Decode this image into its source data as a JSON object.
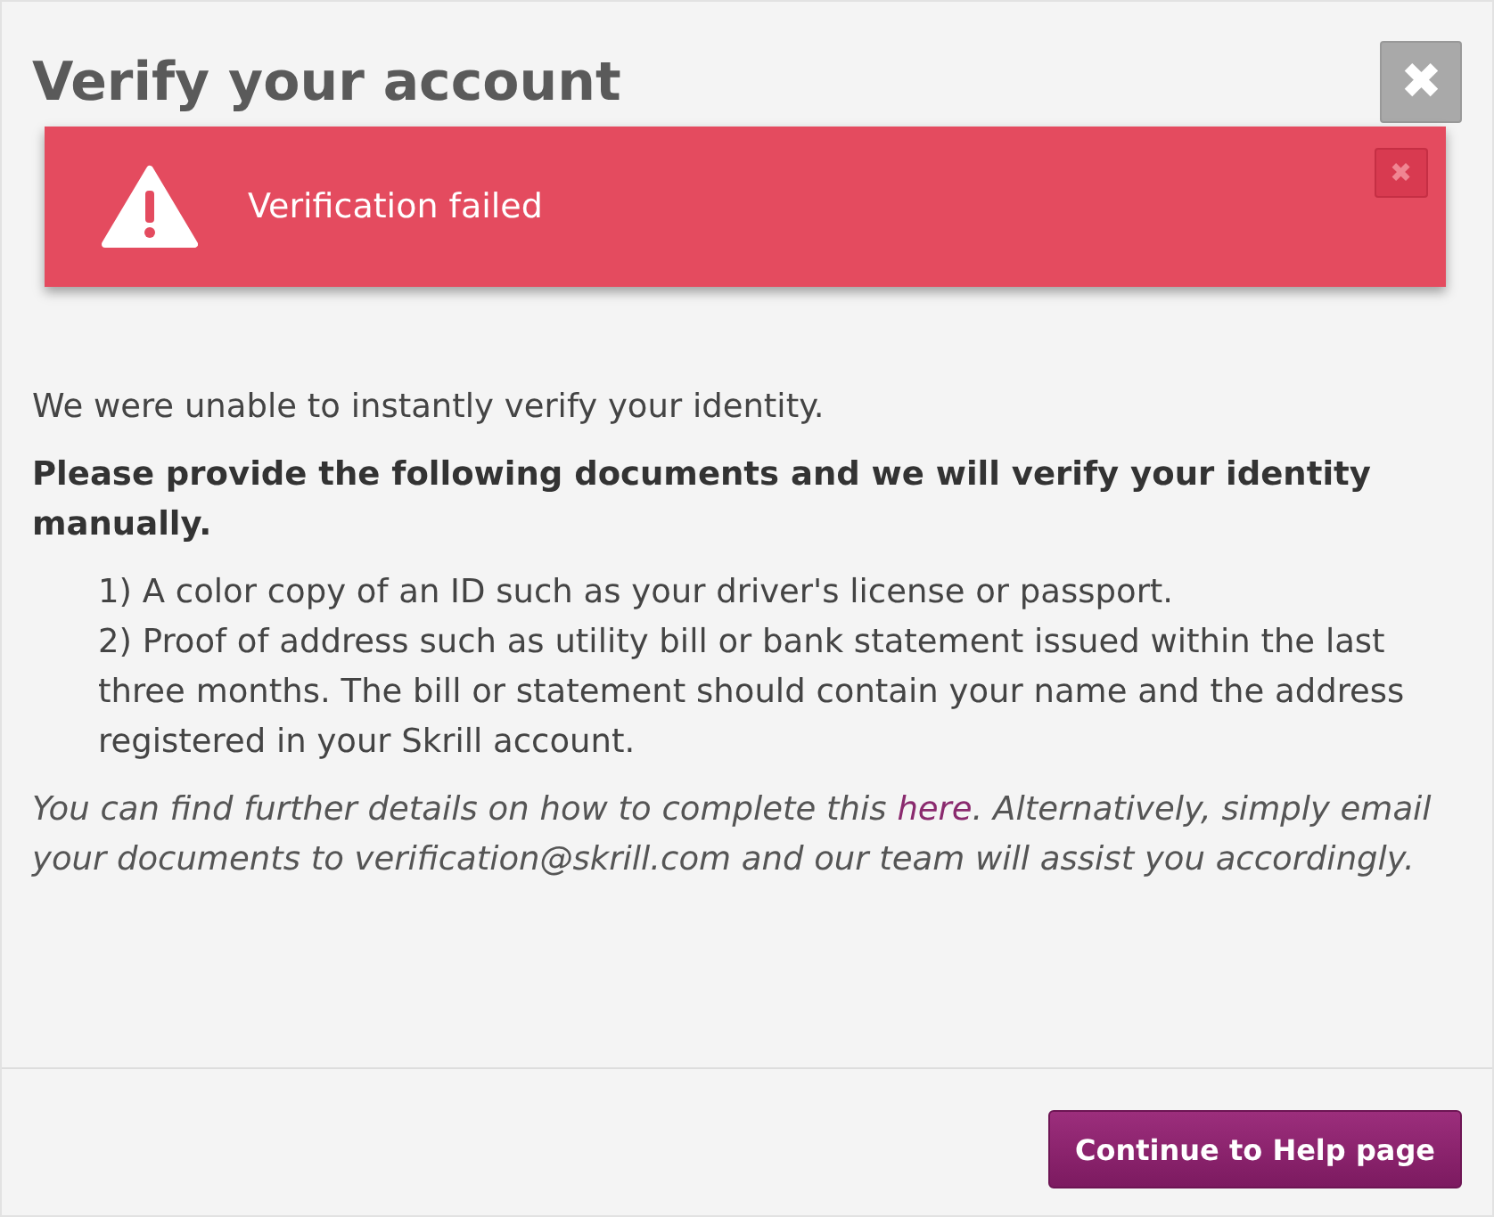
{
  "dialog": {
    "title": "Verify your account",
    "close_label": "✖"
  },
  "alert": {
    "message": "Verification failed",
    "close_label": "✖"
  },
  "intro": "We were unable to instantly verify your identity.",
  "instruction": "Please provide the following documents and we will verify your identity manually.",
  "documents": [
    "1) A color copy of an ID such as your driver's license or passport.",
    "2) Proof of address such as utility bill or bank statement issued within the last three months. The bill or statement should contain your name and the address registered in your Skrill account."
  ],
  "note": {
    "before": "You can find further details on how to complete this ",
    "link": "here",
    "after": ". Alternatively, simply email your documents to verification@skrill.com and our team will assist you accordingly."
  },
  "footer": {
    "button": "Continue to Help page"
  }
}
